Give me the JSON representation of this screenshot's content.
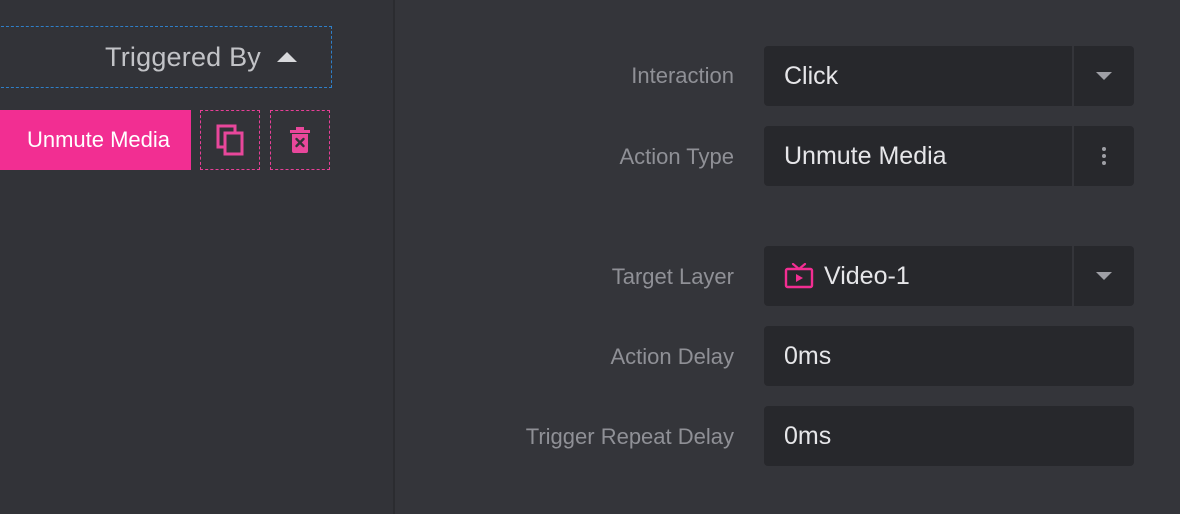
{
  "left": {
    "triggered_by_label": "Triggered By",
    "action_pill_label": "Unmute Media",
    "copy_icon": "copy-icon",
    "delete_icon": "trash-x-icon"
  },
  "form": {
    "interaction": {
      "label": "Interaction",
      "value": "Click"
    },
    "action_type": {
      "label": "Action Type",
      "value": "Unmute Media"
    },
    "target_layer": {
      "label": "Target Layer",
      "value": "Video-1",
      "icon": "tv-icon"
    },
    "action_delay": {
      "label": "Action Delay",
      "value": "0ms"
    },
    "trigger_repeat_delay": {
      "label": "Trigger Repeat Delay",
      "value": "0ms"
    }
  },
  "colors": {
    "accent": "#f22e92",
    "dashed_blue": "#2f7fc8",
    "background": "#34353a",
    "field_bg": "#27282c"
  }
}
